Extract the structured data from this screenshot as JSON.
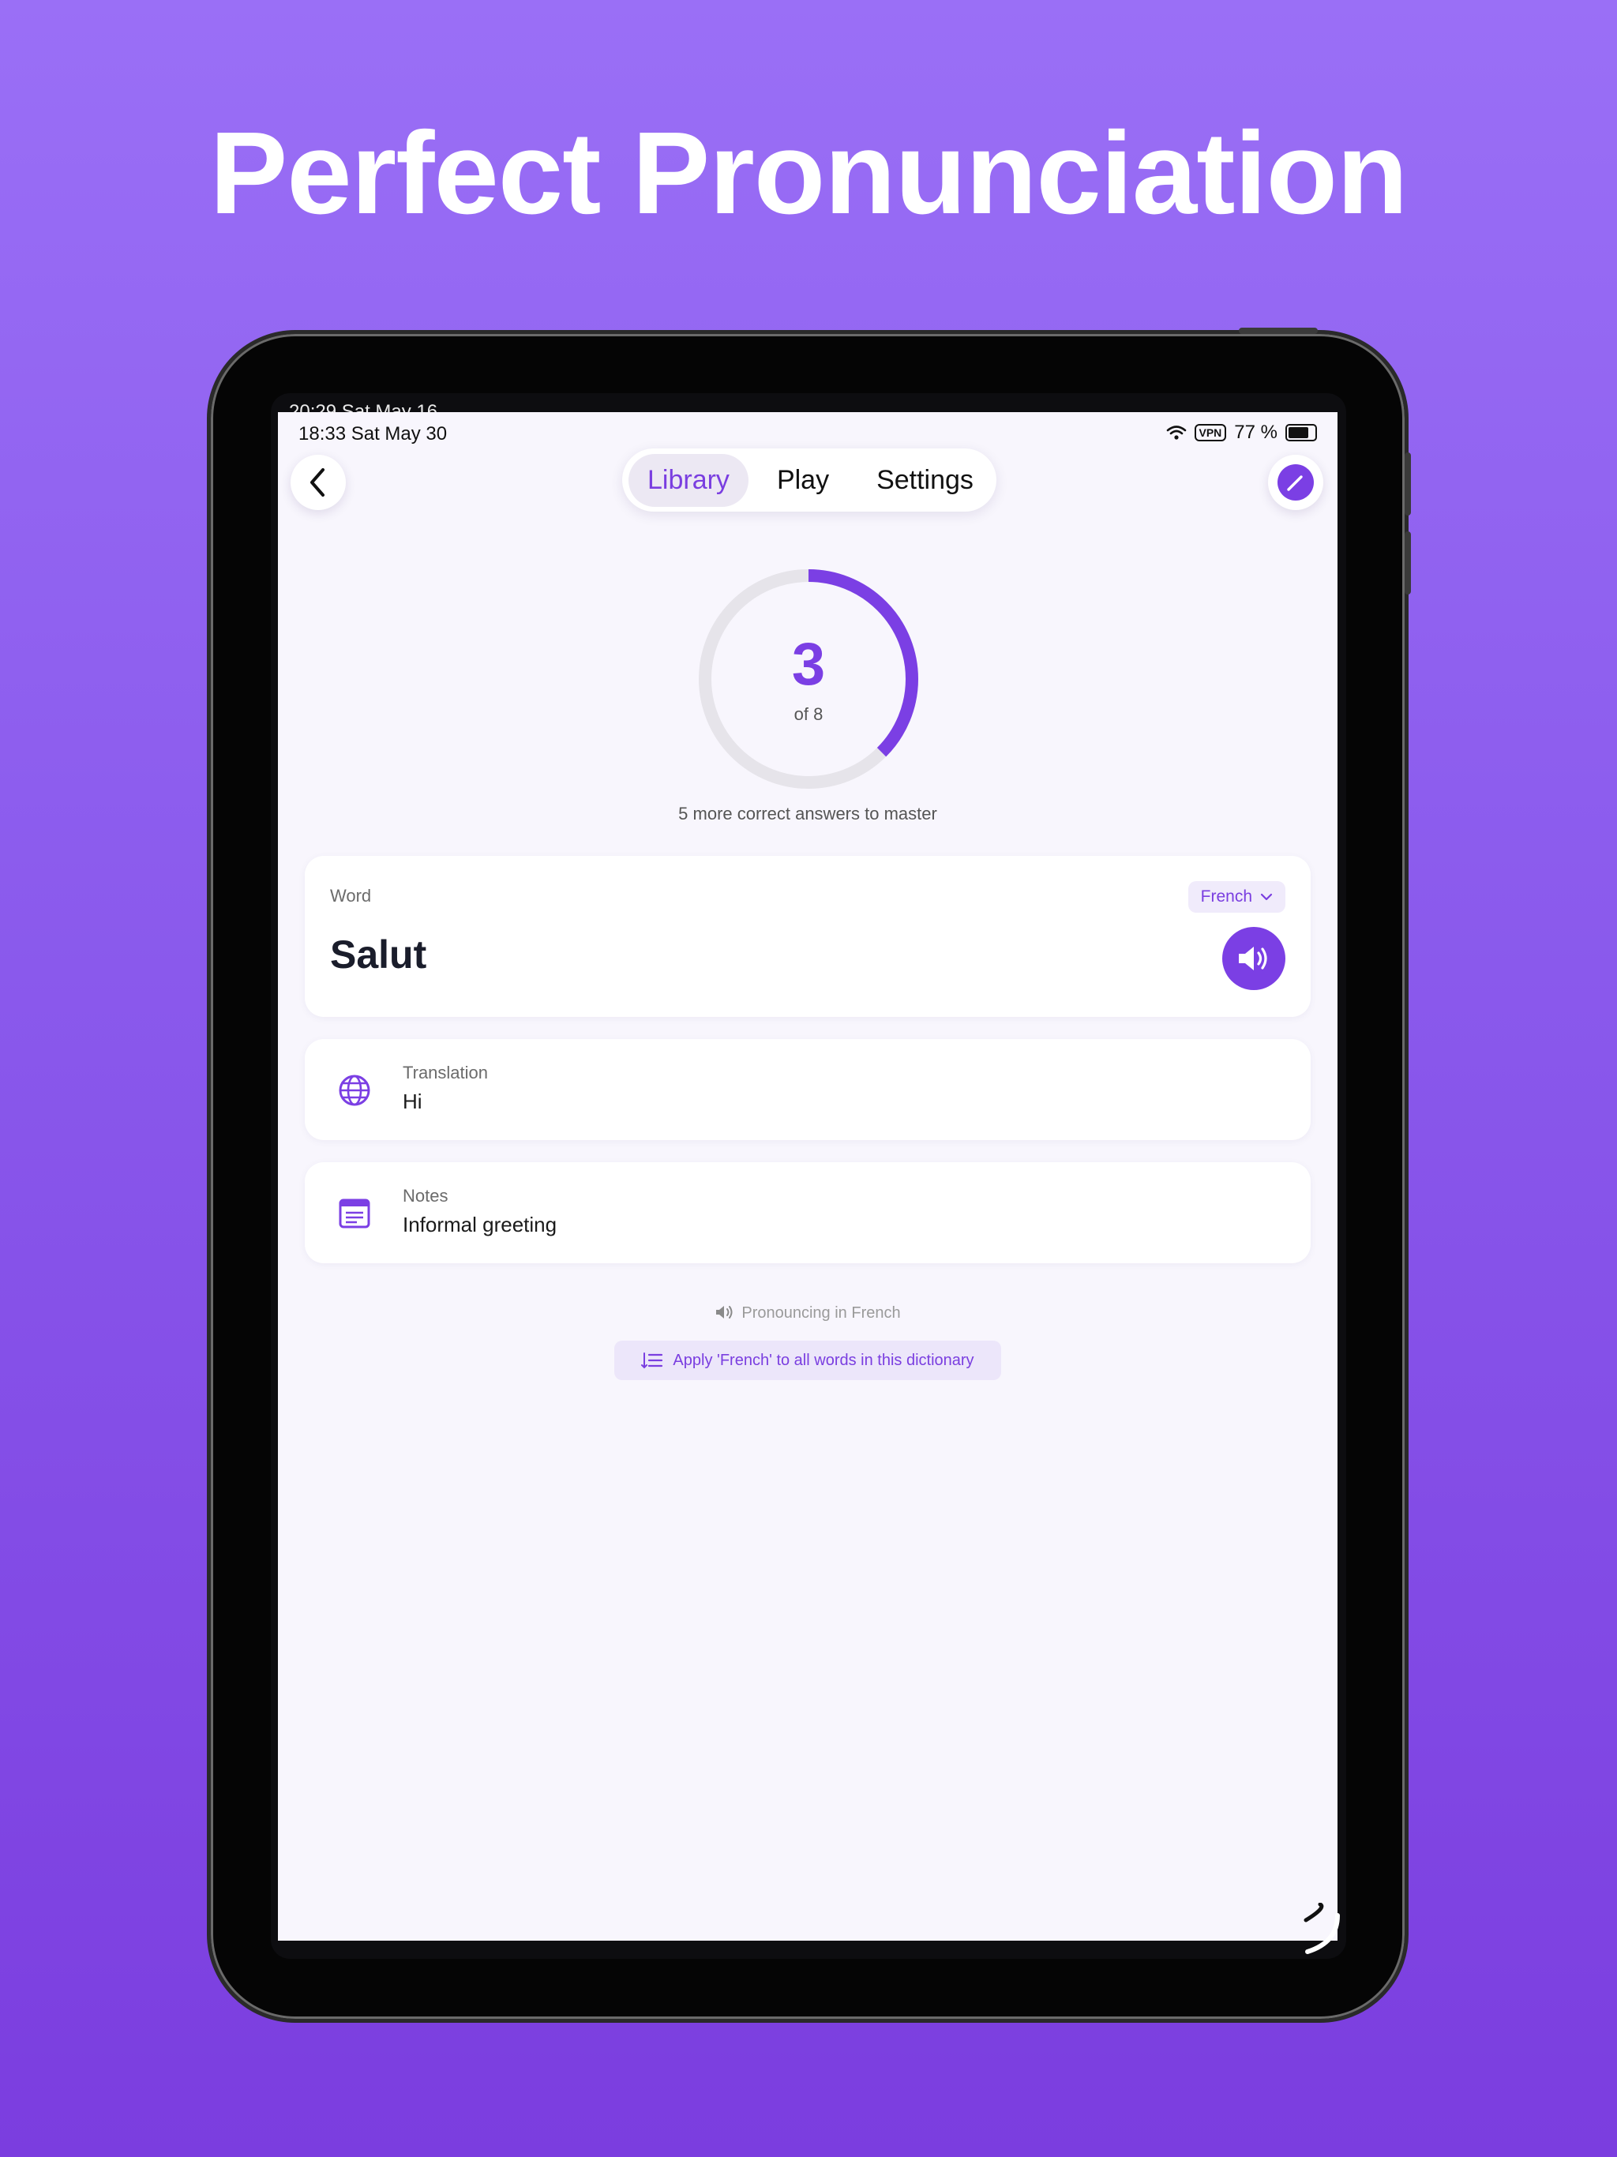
{
  "headline": "Perfect Pronunciation",
  "ghost_status": "20:29  Sat May 16",
  "status_bar": {
    "time_date": "18:33   Sat May 30",
    "vpn": "VPN",
    "battery_text": "77 %"
  },
  "tabs": [
    {
      "label": "Library",
      "active": true
    },
    {
      "label": "Play",
      "active": false
    },
    {
      "label": "Settings",
      "active": false
    }
  ],
  "progress": {
    "correct": "3",
    "of_text": "of 8",
    "total": 8,
    "fraction": 0.375,
    "caption": "5 more correct answers to master"
  },
  "word_card": {
    "label": "Word",
    "word": "Salut",
    "language": "French"
  },
  "translation": {
    "label": "Translation",
    "value": "Hi"
  },
  "notes": {
    "label": "Notes",
    "value": "Informal greeting"
  },
  "pronouncing_text": "Pronouncing in French",
  "apply_button": "Apply 'French' to all words in this dictionary",
  "colors": {
    "accent": "#7b3fe4",
    "background_top": "#9a6ff6",
    "background_bottom": "#7b3ddf",
    "screen": "#f8f6fd"
  },
  "icons": [
    "back-chevron-icon",
    "edit-pencil-icon",
    "speaker-icon",
    "globe-icon",
    "notes-icon",
    "chevron-down-icon",
    "list-apply-icon",
    "wifi-icon",
    "battery-icon"
  ]
}
